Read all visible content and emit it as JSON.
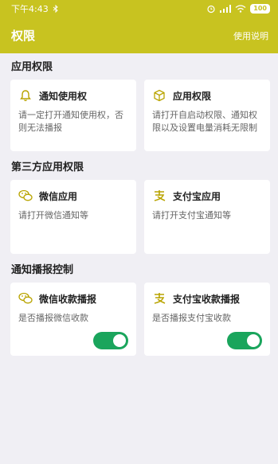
{
  "status": {
    "time": "下午4:43",
    "battery": "100"
  },
  "header": {
    "title": "权限",
    "help_label": "使用说明"
  },
  "sections": [
    {
      "title": "应用权限",
      "cards": [
        {
          "title": "通知使用权",
          "desc": "请一定打开通知使用权，否则无法播报",
          "icon": "bell-icon"
        },
        {
          "title": "应用权限",
          "desc": "请打开自启动权限、通知权限以及设置电量消耗无限制",
          "icon": "cube-icon"
        }
      ]
    },
    {
      "title": "第三方应用权限",
      "cards": [
        {
          "title": "微信应用",
          "desc": "请打开微信通知等",
          "icon": "wechat-icon"
        },
        {
          "title": "支付宝应用",
          "desc": "请打开支付宝通知等",
          "icon": "alipay-icon"
        }
      ]
    },
    {
      "title": "通知播报控制",
      "cards": [
        {
          "title": "微信收款播报",
          "desc": "是否播报微信收款",
          "icon": "wechat-icon",
          "toggle_on": true
        },
        {
          "title": "支付宝收款播报",
          "desc": "是否播报支付宝收款",
          "icon": "alipay-icon",
          "toggle_on": true
        }
      ]
    }
  ],
  "colors": {
    "accent": "#c8c320",
    "toggle_on": "#1aa55c",
    "background": "#f0eff4"
  }
}
